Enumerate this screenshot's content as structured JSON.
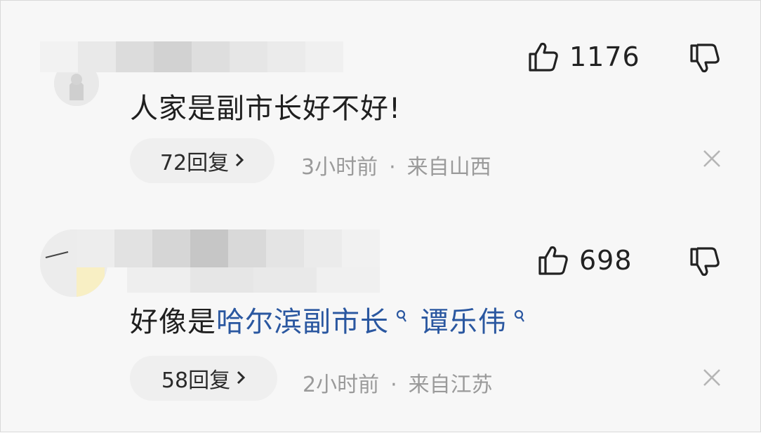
{
  "comments": [
    {
      "content": [
        {
          "text": "人家是副市长好不好!",
          "link": false
        }
      ],
      "likes": "1176",
      "reply_label": "72回复",
      "time": "3小时前",
      "separator": "·",
      "location": "来自山西"
    },
    {
      "content": [
        {
          "text": "好像是",
          "link": false
        },
        {
          "text": "哈尔滨副市长",
          "link": true
        },
        {
          "text": "谭乐伟",
          "link": true
        }
      ],
      "likes": "698",
      "reply_label": "58回复",
      "time": "2小时前",
      "separator": "·",
      "location": "来自江苏"
    }
  ],
  "icons": {
    "like": "thumbs-up-icon",
    "dislike": "thumbs-down-icon",
    "reply_arrow": "chevron-right-icon",
    "close": "close-icon",
    "search": "search-icon"
  },
  "colors": {
    "link": "#2a57a0",
    "meta": "#9a9a9a",
    "pill": "#efefef",
    "background": "#f7f7f7"
  }
}
